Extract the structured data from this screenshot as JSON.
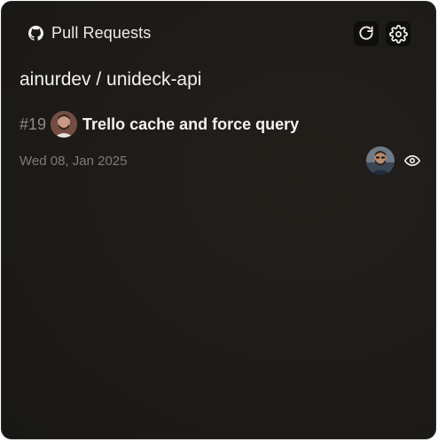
{
  "header": {
    "title": "Pull Requests",
    "icon": "github-icon",
    "refresh_icon": "refresh-icon",
    "settings_icon": "gear-icon"
  },
  "repo": {
    "name": "ainurdev / unideck-api"
  },
  "pull_requests": [
    {
      "number": "#19",
      "title": "Trello cache and force query",
      "date": "Wed 08, Jan 2025",
      "author_avatar_icon": "author-avatar",
      "reviewer_avatar_icon": "reviewer-avatar",
      "view_icon": "eye-icon"
    }
  ],
  "colors": {
    "background": "#1d1b18",
    "text": "#f4f2ef",
    "muted": "#7f7b76",
    "button_bg": "#0f0e0d"
  }
}
